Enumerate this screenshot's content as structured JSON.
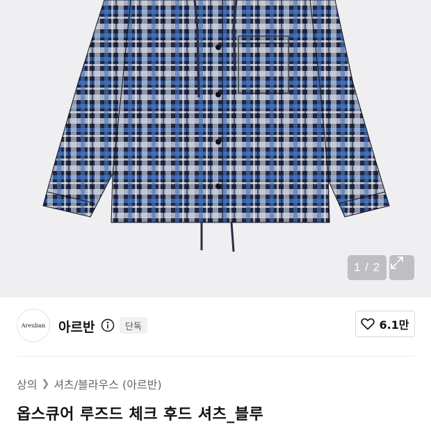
{
  "gallery": {
    "counter": "1 / 2",
    "image_alt": "product-photo"
  },
  "brand": {
    "logo_text": "Areuban",
    "name": "아르반",
    "badge": "단독",
    "likes": "6.1만"
  },
  "breadcrumb": {
    "items": [
      "상의",
      "셔츠/블라우스 (아르반)"
    ]
  },
  "product": {
    "title": "옵스큐어 루즈드 체크 후드 셔츠_블루"
  },
  "icons": {
    "expand": "expand-icon",
    "info": "info-icon",
    "heart": "heart-icon",
    "chevron": "chevron-right-icon"
  }
}
